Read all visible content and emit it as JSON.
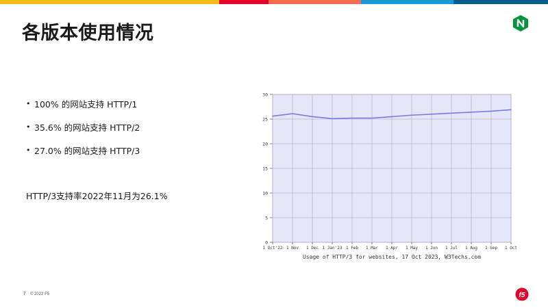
{
  "slide": {
    "title": "各版本使用情况",
    "page_number": "7",
    "copyright": "© 2022 F5"
  },
  "bullets": [
    {
      "text": "100% 的网站支持 HTTP/1"
    },
    {
      "text": "35.6% 的网站支持 HTTP/2"
    },
    {
      "text": "27.0% 的网站支持 HTTP/3"
    }
  ],
  "summary": "HTTP/3支持率2022年11月为26.1%",
  "colors": {
    "topbar": [
      "#f5bd1e",
      "#e4002b",
      "#f26c4f",
      "#199ad6",
      "#005c8a"
    ],
    "nginx": "#009639",
    "f5": "#e4002b",
    "plot_bg": "#e6e6fa",
    "line": "#7a7ae6"
  },
  "chart_data": {
    "type": "line",
    "caption": "Usage of HTTP/3 for websites, 17 Oct 2023, W3Techs.com",
    "categories": [
      "1 Oct'22",
      "1 Nov",
      "1 Dec",
      "1 Jan'23",
      "1 Feb",
      "1 Mar",
      "1 Apr",
      "1 May",
      "1 Jun",
      "1 Jul",
      "1 Aug",
      "1 Sep",
      "1 Oct"
    ],
    "series": [
      {
        "values": [
          25.6,
          26.1,
          25.5,
          25.1,
          25.2,
          25.2,
          25.5,
          25.8,
          26.0,
          26.2,
          26.4,
          26.6,
          26.9
        ]
      }
    ],
    "y_ticks": [
      0,
      5,
      10,
      15,
      20,
      25,
      30
    ],
    "ylim": [
      0,
      30
    ],
    "grid": true
  }
}
